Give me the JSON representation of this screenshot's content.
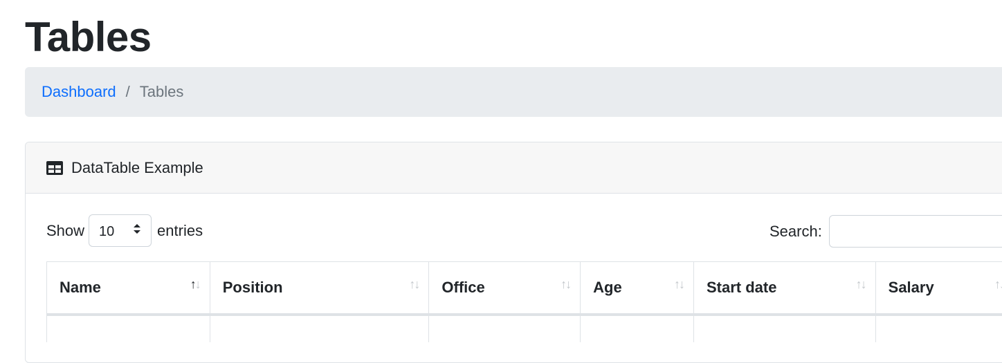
{
  "page": {
    "title": "Tables"
  },
  "breadcrumb": {
    "link": "Dashboard",
    "separator": "/",
    "active": "Tables"
  },
  "card": {
    "title": "DataTable Example",
    "icon": "table-icon"
  },
  "controls": {
    "show_label": "Show",
    "entries_value": "10",
    "entries_label": "entries",
    "search_label": "Search:",
    "search_value": ""
  },
  "table": {
    "columns": [
      "Name",
      "Position",
      "Office",
      "Age",
      "Start date",
      "Salary"
    ],
    "sorted_column": "Name",
    "sort_direction": "ascending"
  }
}
